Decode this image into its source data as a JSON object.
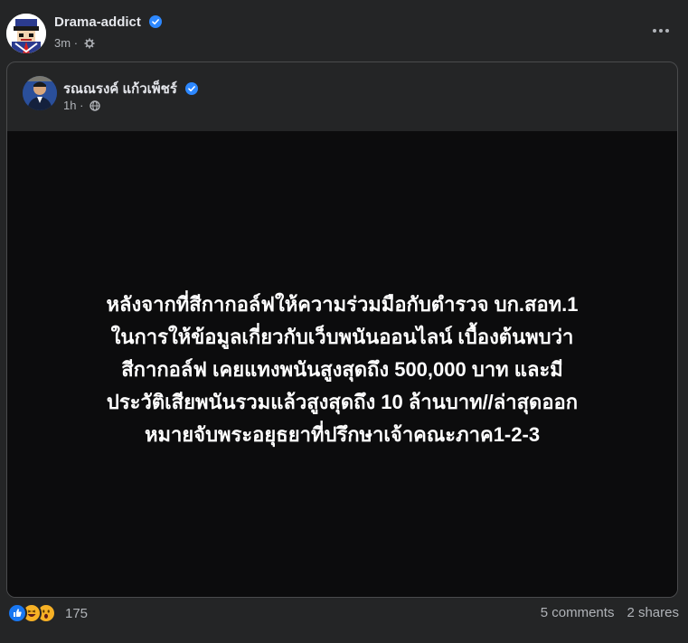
{
  "post": {
    "author": "Drama-addict",
    "time": "3m",
    "privacy_icon": "gear-icon",
    "more_icon": "more-horizontal-icon"
  },
  "shared_post": {
    "author": "รณณรงค์ แก้วเพ็ชร์",
    "time": "1h",
    "privacy_icon": "globe-icon",
    "text_lines": [
      "หลังจากที่สีกากอล์ฟให้ความร่วมมือกับตำรวจ บก.สอท.1",
      "ในการให้ข้อมูลเกี่ยวกับเว็บพนันออนไลน์ เบื้องต้นพบว่า",
      "สีกากอล์ฟ เคยแทงพนันสูงสุดถึง 500,000 บาท และมี",
      "ประวัติเสียพนันรวมแล้วสูงสุดถึง 10 ล้านบาท//ล่าสุดออก",
      "หมายจับพระอยุธยาที่ปรึกษาเจ้าคณะภาค1-2-3"
    ]
  },
  "footer": {
    "reaction_icons": [
      "like-icon",
      "haha-icon",
      "wow-icon"
    ],
    "reaction_count": "175",
    "comments": "5 comments",
    "shares": "2 shares"
  },
  "colors": {
    "background": "#242526",
    "text_panel": "#0c0c0d",
    "verified": "#2d88ff",
    "like": "#1877f2",
    "emoji": "#f7b125"
  }
}
